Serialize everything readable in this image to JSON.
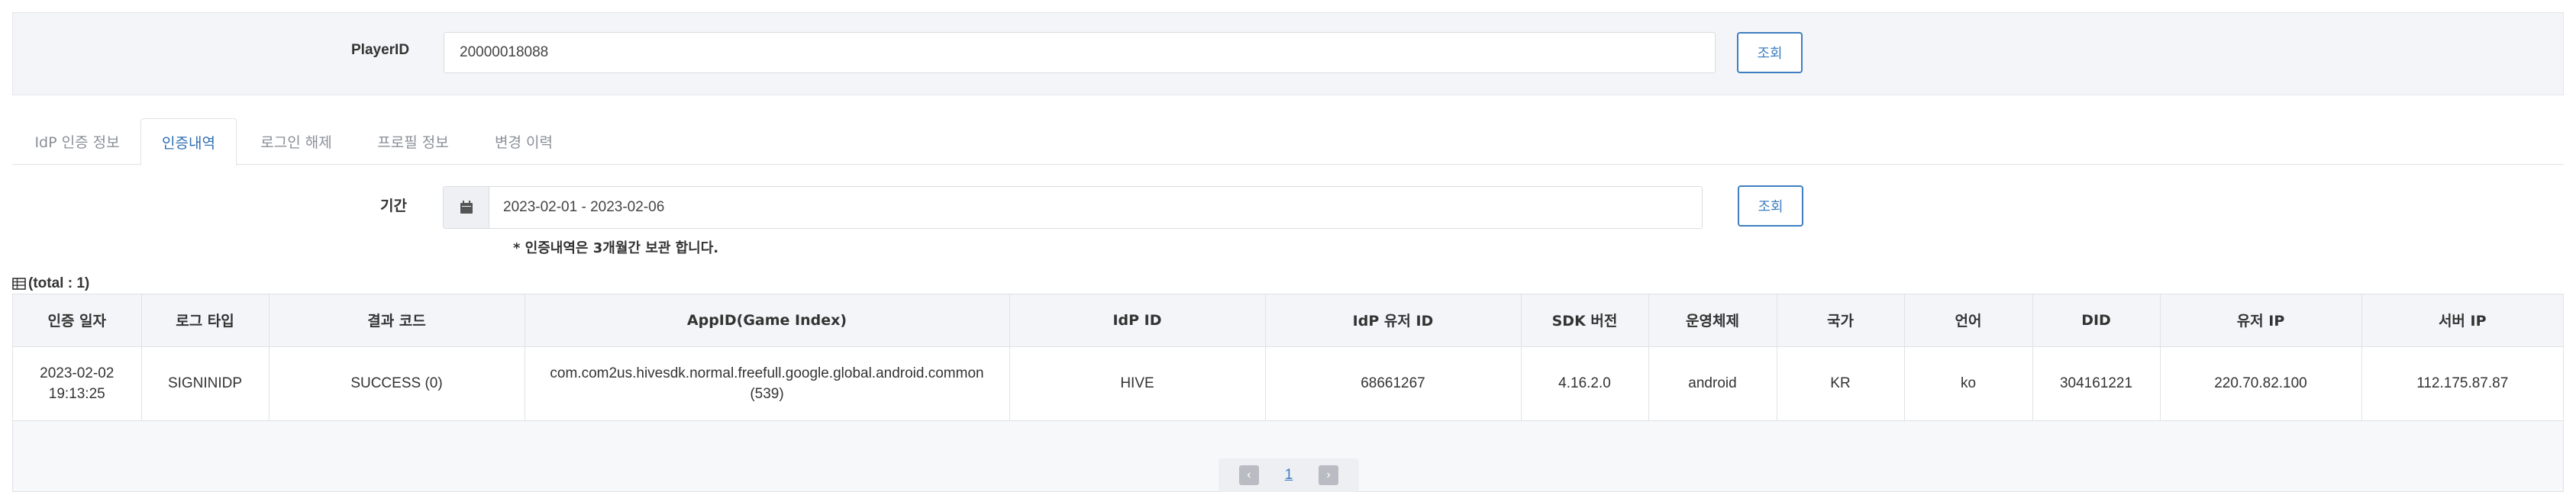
{
  "search": {
    "label": "PlayerID",
    "value": "20000018088",
    "button": "조회"
  },
  "tabs": [
    {
      "label": "IdP 인증 정보",
      "active": false
    },
    {
      "label": "인증내역",
      "active": true
    },
    {
      "label": "로그인 해제",
      "active": false
    },
    {
      "label": "프로필 정보",
      "active": false
    },
    {
      "label": "변경 이력",
      "active": false
    }
  ],
  "period": {
    "label": "기간",
    "value": "2023-02-01 - 2023-02-06",
    "button": "조회",
    "icon": "calendar-icon",
    "note": "* 인증내역은 3개월간 보관 합니다."
  },
  "total": {
    "text": "(total : 1)",
    "icon": "table-icon"
  },
  "table": {
    "headers": [
      "인증 일자",
      "로그 타입",
      "결과 코드",
      "AppID(Game Index)",
      "IdP ID",
      "IdP 유저 ID",
      "SDK 버전",
      "운영체제",
      "국가",
      "언어",
      "DID",
      "유저 IP",
      "서버 IP"
    ],
    "rows": [
      {
        "date_line1": "2023-02-02",
        "date_line2": "19:13:25",
        "log_type": "SIGNINIDP",
        "result_code": "SUCCESS (0)",
        "appid_line1": "com.com2us.hivesdk.normal.freefull.google.global.android.common",
        "appid_line2": "(539)",
        "idp_id": "HIVE",
        "idp_user_id": "68661267",
        "sdk_version": "4.16.2.0",
        "os": "android",
        "country": "KR",
        "language": "ko",
        "did": "304161221",
        "user_ip": "220.70.82.100",
        "server_ip": "112.175.87.87"
      }
    ]
  },
  "pagination": {
    "prev_icon": "chevron-left-icon",
    "page": "1",
    "next_icon": "chevron-right-icon"
  },
  "colors": {
    "accent": "#3e7fc1",
    "panel_bg": "#f4f5f8"
  }
}
